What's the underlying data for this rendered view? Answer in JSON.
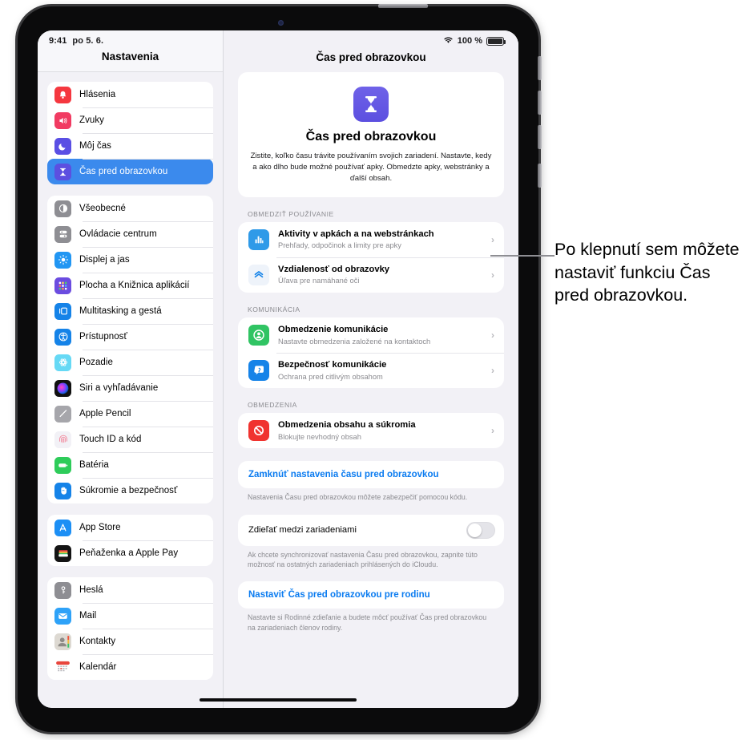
{
  "status_bar": {
    "time": "9:41",
    "date": "po 5. 6.",
    "wifi_icon": "wifi-icon",
    "battery_percent": "100 %",
    "battery_icon": "battery-full-icon"
  },
  "sidebar": {
    "title": "Nastavenia",
    "groups": [
      {
        "items": [
          {
            "label": "Hlásenia",
            "icon": "notifications-icon",
            "selected": false
          },
          {
            "label": "Zvuky",
            "icon": "sounds-icon",
            "selected": false
          },
          {
            "label": "Môj čas",
            "icon": "focus-moon-icon",
            "selected": false
          },
          {
            "label": "Čas pred obrazovkou",
            "icon": "screen-time-hourglass-icon",
            "selected": true
          }
        ]
      },
      {
        "items": [
          {
            "label": "Všeobecné",
            "icon": "general-gear-icon",
            "selected": false
          },
          {
            "label": "Ovládacie centrum",
            "icon": "control-center-icon",
            "selected": false
          },
          {
            "label": "Displej a jas",
            "icon": "display-brightness-icon",
            "selected": false
          },
          {
            "label": "Plocha a Knižnica aplikácií",
            "icon": "home-screen-icon",
            "selected": false
          },
          {
            "label": "Multitasking a gestá",
            "icon": "multitasking-icon",
            "selected": false
          },
          {
            "label": "Prístupnosť",
            "icon": "accessibility-icon",
            "selected": false
          },
          {
            "label": "Pozadie",
            "icon": "wallpaper-icon",
            "selected": false
          },
          {
            "label": "Siri a vyhľadávanie",
            "icon": "siri-icon",
            "selected": false
          },
          {
            "label": "Apple Pencil",
            "icon": "apple-pencil-icon",
            "selected": false
          },
          {
            "label": "Touch ID a kód",
            "icon": "touch-id-icon",
            "selected": false
          },
          {
            "label": "Batéria",
            "icon": "battery-icon",
            "selected": false
          },
          {
            "label": "Súkromie a bezpečnosť",
            "icon": "privacy-hand-icon",
            "selected": false
          }
        ]
      },
      {
        "items": [
          {
            "label": "App Store",
            "icon": "app-store-icon",
            "selected": false
          },
          {
            "label": "Peňaženka a Apple Pay",
            "icon": "wallet-icon",
            "selected": false
          }
        ]
      },
      {
        "items": [
          {
            "label": "Heslá",
            "icon": "passwords-key-icon",
            "selected": false
          },
          {
            "label": "Mail",
            "icon": "mail-icon",
            "selected": false
          },
          {
            "label": "Kontakty",
            "icon": "contacts-icon",
            "selected": false
          },
          {
            "label": "Kalendár",
            "icon": "calendar-icon",
            "selected": false
          }
        ]
      }
    ]
  },
  "detail": {
    "title": "Čas pred obrazovkou",
    "hero": {
      "icon": "screen-time-hourglass-icon",
      "title": "Čas pred obrazovkou",
      "description": "Zistite, koľko času trávite používaním svojich zariadení. Nastavte, kedy a ako dlho bude možné používať apky. Obmedzte apky, webstránky a ďalší obsah."
    },
    "sections": [
      {
        "label": "OBMEDZIŤ POUŽÍVANIE",
        "cells": [
          {
            "title": "Aktivity v apkách a na webstránkach",
            "subtitle": "Prehľady, odpočinok a limity pre apky",
            "icon": "app-activity-chart-icon",
            "chevron": "›"
          },
          {
            "title": "Vzdialenosť od obrazovky",
            "subtitle": "Úľava pre namáhané oči",
            "icon": "screen-distance-icon",
            "chevron": "›"
          }
        ]
      },
      {
        "label": "KOMUNIKÁCIA",
        "cells": [
          {
            "title": "Obmedzenie komunikácie",
            "subtitle": "Nastavte obmedzenia založené na kontaktoch",
            "icon": "communication-limits-icon",
            "chevron": "›"
          },
          {
            "title": "Bezpečnosť komunikácie",
            "subtitle": "Ochrana pred citlivým obsahom",
            "icon": "communication-safety-icon",
            "chevron": "›"
          }
        ]
      },
      {
        "label": "OBMEDZENIA",
        "cells": [
          {
            "title": "Obmedzenia obsahu a súkromia",
            "subtitle": "Blokujte nevhodný obsah",
            "icon": "content-restrictions-icon",
            "chevron": "›"
          }
        ]
      }
    ],
    "lock_link": "Zamknúť nastavenia času pred obrazovkou",
    "lock_footnote": "Nastavenia Času pred obrazovkou môžete zabezpečiť pomocou kódu.",
    "share_toggle": {
      "label": "Zdieľať medzi zariadeniami",
      "value": "off"
    },
    "share_footnote": "Ak chcete synchronizovať nastavenia Času pred obrazovkou, zapnite túto možnosť na ostatných zariadeniach prihlásených do iCloudu.",
    "family_link": "Nastaviť Čas pred obrazovkou pre rodinu",
    "family_footnote": "Nastavte si Rodinné zdieľanie a budete môcť používať Čas pred obrazovkou na zariadeniach členov rodiny."
  },
  "callout": {
    "text": "Po klepnutí sem môžete nastaviť funkciu Čas pred obrazovkou."
  },
  "colors": {
    "accent_blue": "#3b8aed",
    "link_blue": "#0a7bf0",
    "screen_time_purple": "#5c4fe0",
    "background": "#f2f1f6"
  }
}
